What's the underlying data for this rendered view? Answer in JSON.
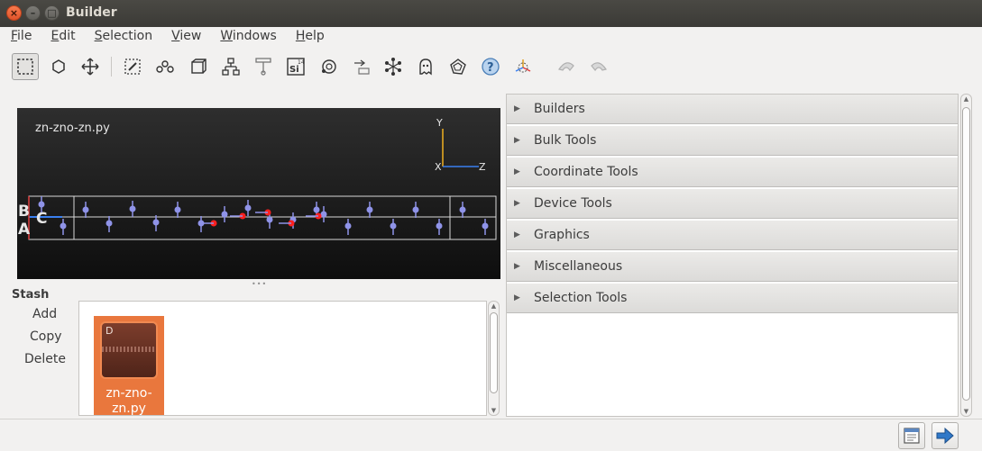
{
  "window": {
    "title": "Builder",
    "close_glyph": "×",
    "min_glyph": "–",
    "max_glyph": "□"
  },
  "menu": {
    "items": [
      {
        "first": "F",
        "rest": "ile"
      },
      {
        "first": "E",
        "rest": "dit"
      },
      {
        "first": "S",
        "rest": "election"
      },
      {
        "first": "V",
        "rest": "iew"
      },
      {
        "first": "W",
        "rest": "indows"
      },
      {
        "first": "H",
        "rest": "elp"
      }
    ]
  },
  "toolbar": {
    "tools": [
      "select-rectangle-icon",
      "select-atom-icon",
      "move-icon",
      "select-region-icon",
      "bond-icon",
      "cell-icon",
      "network-icon",
      "tree-icon",
      "element-si-icon",
      "molecule-icon",
      "export-icon",
      "graph-icon",
      "ghost-icon",
      "rotate-view-icon",
      "help-icon",
      "axes-icon",
      "undo-icon",
      "redo-icon"
    ],
    "si_label": "Si",
    "si_number": "14"
  },
  "viewport": {
    "title": "zn-zno-zn.py",
    "axes": {
      "y": "Y",
      "x": "X",
      "z": "Z"
    },
    "cell_labels": {
      "b": "B",
      "c": "C",
      "a": "A"
    },
    "colors": {
      "atom": "#8f93e8",
      "highlight": "#ff2020",
      "frame": "#d8d8d8",
      "y_axis": "#f0b020",
      "z_axis": "#3a7ff0"
    }
  },
  "stash": {
    "title": "Stash",
    "add_label": "Add",
    "copy_label": "Copy",
    "delete_label": "Delete",
    "items": [
      {
        "thumb_label": "D",
        "name_line1": "zn-zno-",
        "name_line2": "zn.py"
      }
    ]
  },
  "panel": {
    "sections": [
      "Builders",
      "Bulk Tools",
      "Coordinate Tools",
      "Device Tools",
      "Graphics",
      "Miscellaneous",
      "Selection Tools"
    ]
  },
  "colors": {
    "accent": "#e9773d",
    "arrow_blue": "#2f78c8"
  }
}
